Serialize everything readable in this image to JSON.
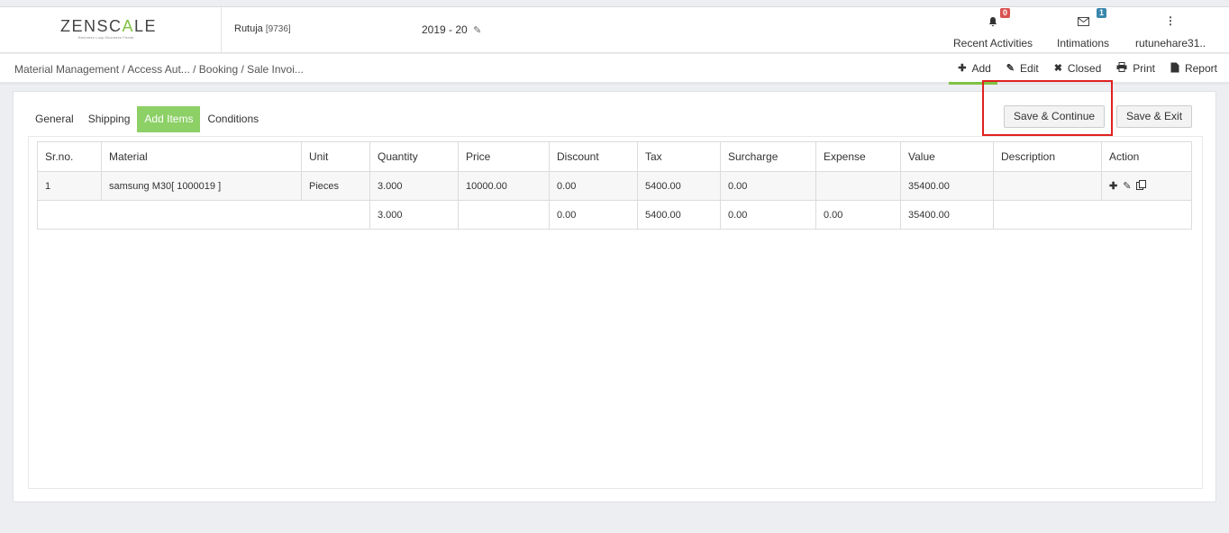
{
  "header": {
    "logo_main_1": "ZENSC",
    "logo_accent": "A",
    "logo_main_2": "LE",
    "logo_tagline": "Business Loop Business Feeds",
    "user_name": "Rutuja",
    "user_code": "[9736]",
    "fiscal_year": "2019 - 20",
    "recent_activities": {
      "label": "Recent Activities",
      "count": "0"
    },
    "intimations": {
      "label": "Intimations",
      "count": "1"
    },
    "account": {
      "label": "rutunehare31.."
    }
  },
  "breadcrumb": {
    "part1": "Material Management",
    "part2": " / Access Aut...",
    "part3": " / Booking",
    "part4": " / Sale Invoi..."
  },
  "toolbar": {
    "add": "Add",
    "edit": "Edit",
    "closed": "Closed",
    "print": "Print",
    "report": "Report"
  },
  "tabs": {
    "general": "General",
    "shipping": "Shipping",
    "add_items": "Add Items",
    "conditions": "Conditions"
  },
  "buttons": {
    "save_continue": "Save & Continue",
    "save_exit": "Save & Exit"
  },
  "table": {
    "headers": {
      "srno": "Sr.no.",
      "material": "Material",
      "unit": "Unit",
      "quantity": "Quantity",
      "price": "Price",
      "discount": "Discount",
      "tax": "Tax",
      "surcharge": "Surcharge",
      "expense": "Expense",
      "value": "Value",
      "description": "Description",
      "action": "Action"
    },
    "rows": [
      {
        "srno": "1",
        "material": "samsung M30[ 1000019 ]",
        "unit": "Pieces",
        "quantity": "3.000",
        "price": "10000.00",
        "discount": "0.00",
        "tax": "5400.00",
        "surcharge": "0.00",
        "expense": "",
        "value": "35400.00",
        "description": ""
      }
    ],
    "totals": {
      "quantity": "3.000",
      "discount": "0.00",
      "tax": "5400.00",
      "surcharge": "0.00",
      "expense": "0.00",
      "value": "35400.00"
    }
  },
  "colors": {
    "accent": "#7fc242",
    "active_tab": "#8cd066",
    "highlight": "#e02020"
  }
}
